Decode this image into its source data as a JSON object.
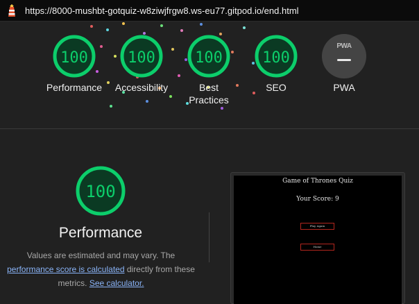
{
  "topbar": {
    "url": "https://8000-mushbt-gotquiz-w8ziwjfrgw8.ws-eu77.gitpod.io/end.html",
    "icon": "lighthouse-icon"
  },
  "summary": {
    "gauges": [
      {
        "score": "100",
        "label": "Performance",
        "status_color": "#0cce6b"
      },
      {
        "score": "100",
        "label": "Accessibility",
        "status_color": "#0cce6b"
      },
      {
        "score": "100",
        "label_lines": [
          "Best",
          "Practices"
        ],
        "status_color": "#0cce6b"
      },
      {
        "score": "100",
        "label": "SEO",
        "status_color": "#0cce6b"
      }
    ],
    "pwa": {
      "badge": "PWA",
      "label": "PWA"
    }
  },
  "detail": {
    "score": "100",
    "title": "Performance",
    "desc_1": "Values are estimated and may vary. The",
    "link_1": "performance score is calculated",
    "desc_2": " directly from these metrics.",
    "link_2": "See calculator."
  },
  "screenshot": {
    "title": "Game of Thrones Quiz",
    "score": "Your Score: 9",
    "button_1": "Play Again",
    "button_2": "Home"
  },
  "colors": {
    "pass": "#0cce6b",
    "pass_fill": "#0b3a23",
    "background": "#212121",
    "link": "#8ab4f8"
  }
}
